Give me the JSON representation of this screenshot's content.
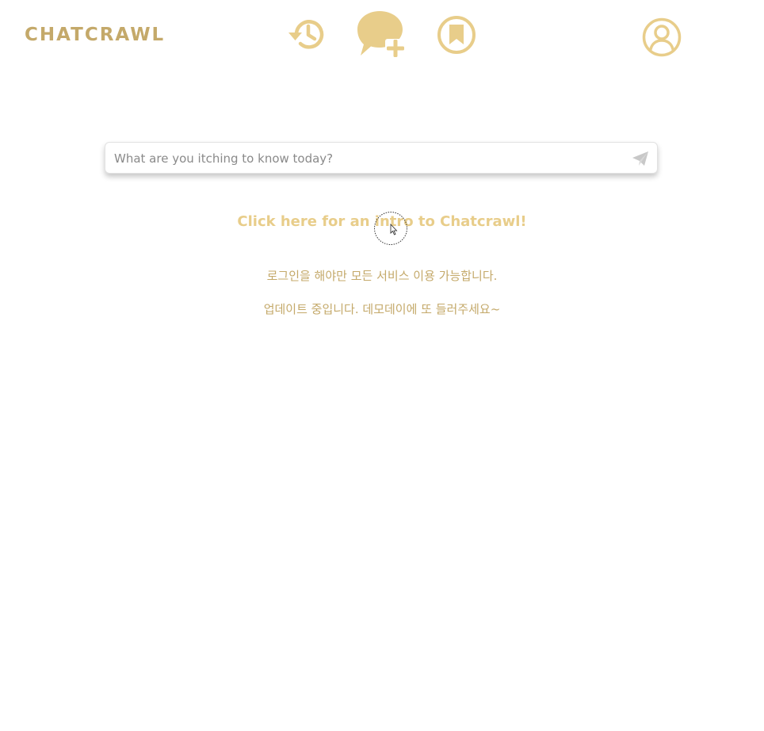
{
  "header": {
    "logo_text": "CHATCRAWL",
    "icons": {
      "history": "history-icon",
      "new_chat": "new-chat-icon",
      "bookmark": "bookmark-icon",
      "profile": "user-profile-icon"
    }
  },
  "search": {
    "placeholder": "What are you itching to know today?",
    "value": "",
    "send_icon": "send-icon"
  },
  "main": {
    "intro_link": "Click here for an intro to Chatcrawl!",
    "notice_login": "로그인을 해야만 모든 서비스 이용 가능합니다.",
    "notice_update": "업데이트 중입니다. 데모데이에 또 들러주세요~"
  },
  "colors": {
    "accent": "#e8cd8a",
    "accent_dark": "#c4a96a",
    "background": "#ffffff"
  }
}
